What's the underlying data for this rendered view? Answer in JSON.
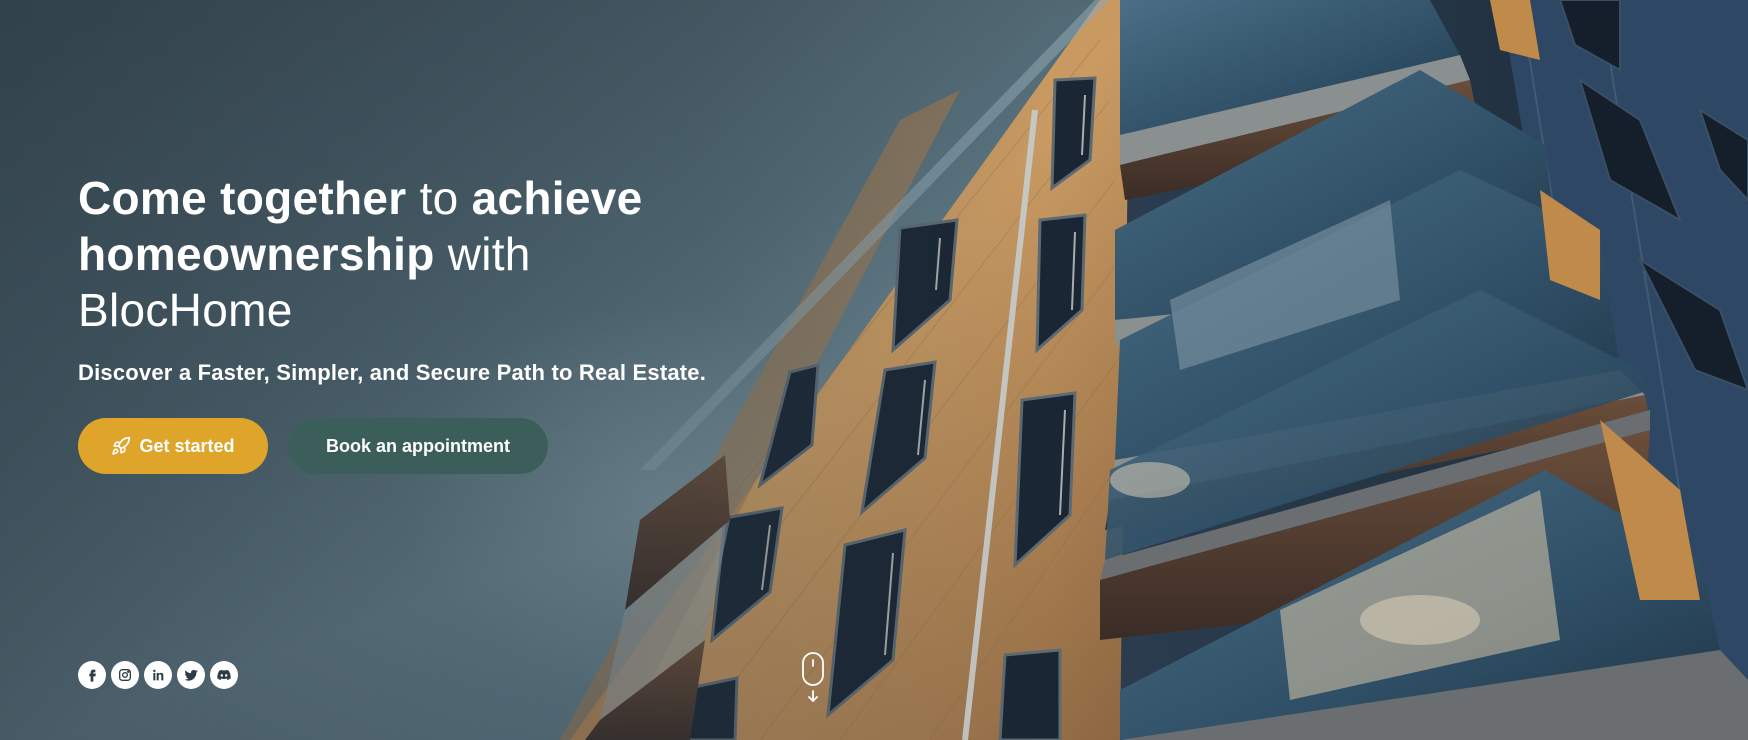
{
  "hero": {
    "headline": {
      "part1_bold": "Come together",
      "part2": " to ",
      "part3_bold": "achieve homeownership",
      "part4": " with ",
      "part5": "BlocHome"
    },
    "subtitle": "Discover a Faster, Simpler, and Secure Path to Real Estate.",
    "primary_button": {
      "label": "Get started",
      "icon": "rocket-icon",
      "color": "#dfa52a"
    },
    "secondary_button": {
      "label": "Book an appointment",
      "color": "#3c5e5a"
    }
  },
  "social": [
    {
      "name": "facebook",
      "icon": "facebook-icon"
    },
    {
      "name": "instagram",
      "icon": "instagram-icon"
    },
    {
      "name": "linkedin",
      "icon": "linkedin-icon"
    },
    {
      "name": "twitter",
      "icon": "twitter-icon"
    },
    {
      "name": "discord",
      "icon": "discord-icon"
    }
  ],
  "scroll_indicator": {
    "icon": "mouse-scroll-icon"
  }
}
